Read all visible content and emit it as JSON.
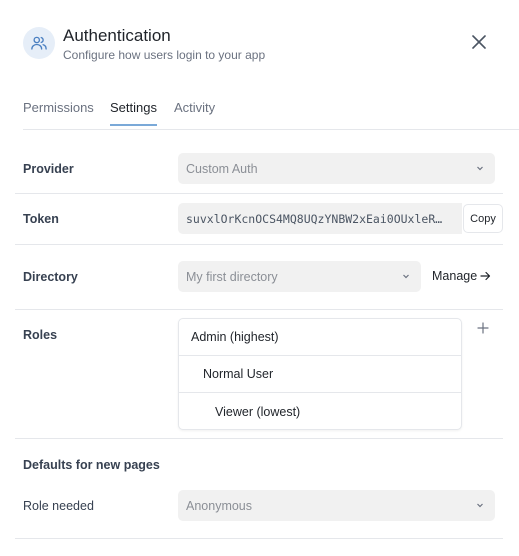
{
  "header": {
    "title": "Authentication",
    "subtitle": "Configure how users login to your app",
    "icon": "users-icon",
    "close_icon": "close-icon",
    "accent": "#7aa9d8"
  },
  "tabs": [
    {
      "label": "Permissions",
      "active": false
    },
    {
      "label": "Settings",
      "active": true
    },
    {
      "label": "Activity",
      "active": false
    }
  ],
  "provider": {
    "label": "Provider",
    "value": "Custom Auth"
  },
  "token": {
    "label": "Token",
    "value": "suvxlOrKcnOCS4MQ8UQzYNBW2xEai0OUxleR…",
    "copy_label": "Copy"
  },
  "directory": {
    "label": "Directory",
    "value": "My first directory",
    "manage_label": "Manage"
  },
  "roles": {
    "label": "Roles",
    "items": [
      "Admin (highest)",
      "Normal User",
      "Viewer (lowest)"
    ]
  },
  "defaults": {
    "section_title": "Defaults for new pages",
    "role_needed_label": "Role needed",
    "role_needed_value": "Anonymous"
  }
}
